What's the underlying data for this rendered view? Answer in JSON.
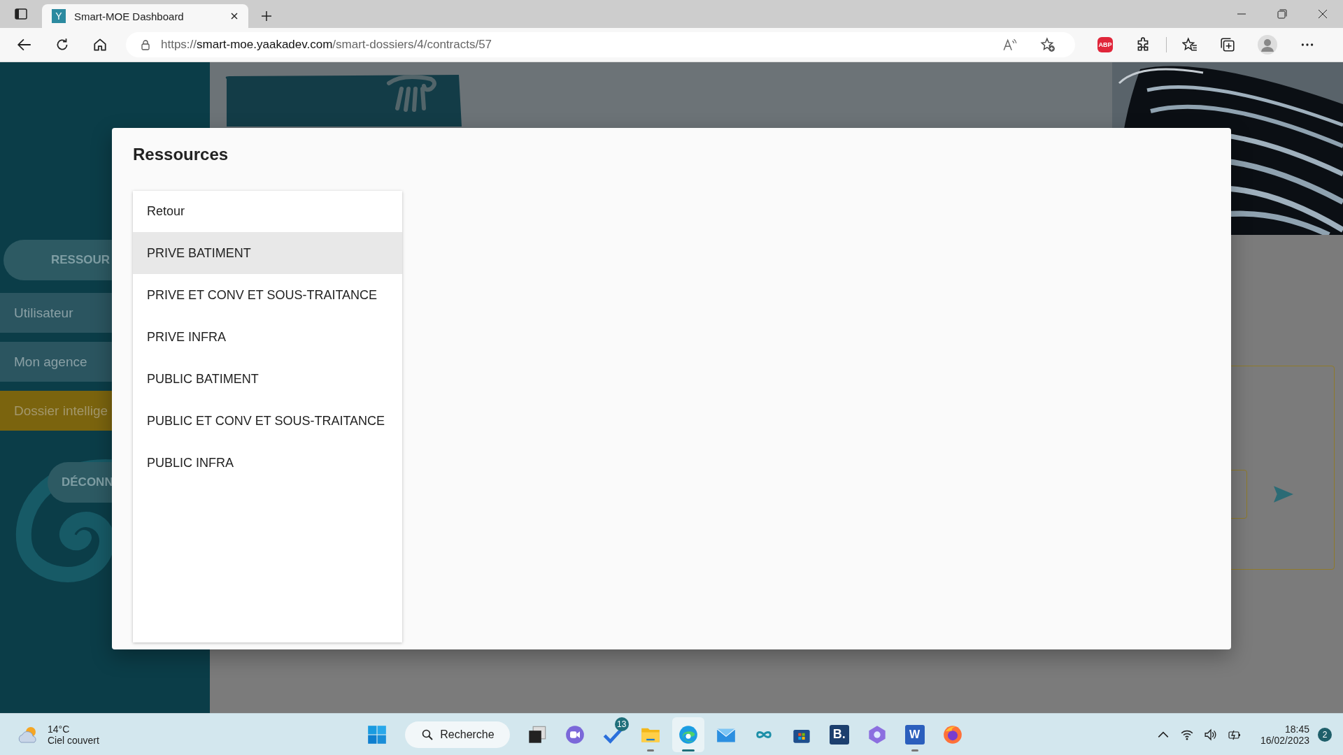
{
  "browser": {
    "tab": {
      "favicon": "Y",
      "title": "Smart-MOE Dashboard",
      "selected": true
    },
    "url": {
      "scheme": "https://",
      "host": "smart-moe.yaakadev.com",
      "path": "/smart-dossiers/4/contracts/57"
    },
    "extension_badge": "ABP"
  },
  "sidebar": {
    "items": [
      {
        "kind": "pill",
        "label": "RESSOUR"
      },
      {
        "kind": "row",
        "label": "Utilisateur",
        "selected": false
      },
      {
        "kind": "row",
        "label": "Mon agence",
        "selected": false
      },
      {
        "kind": "row",
        "label": "Dossier intellige",
        "selected": true
      },
      {
        "kind": "pill",
        "label": "DÉCONN"
      }
    ]
  },
  "modal": {
    "title": "Ressources",
    "items": [
      {
        "label": "Retour",
        "selected": false
      },
      {
        "label": "PRIVE BATIMENT",
        "selected": true
      },
      {
        "label": "PRIVE ET CONV ET SOUS-TRAITANCE",
        "selected": false
      },
      {
        "label": "PRIVE INFRA",
        "selected": false
      },
      {
        "label": "PUBLIC BATIMENT",
        "selected": false
      },
      {
        "label": "PUBLIC ET CONV ET SOUS-TRAITANCE",
        "selected": false
      },
      {
        "label": "PUBLIC INFRA",
        "selected": false
      }
    ]
  },
  "taskbar": {
    "weather": {
      "temperature": "14°C",
      "condition": "Ciel couvert"
    },
    "search": "Recherche",
    "apps": [
      {
        "kind": "taskview",
        "running": false
      },
      {
        "kind": "chat",
        "running": false
      },
      {
        "kind": "todo",
        "badge": "13",
        "running": false
      },
      {
        "kind": "files",
        "running": true
      },
      {
        "kind": "edge",
        "running": true,
        "selected": true
      },
      {
        "kind": "mail",
        "running": false
      },
      {
        "kind": "loop",
        "running": false
      },
      {
        "kind": "store",
        "running": false
      },
      {
        "kind": "letter",
        "label": "B.",
        "running": false
      },
      {
        "kind": "copilot",
        "running": false
      },
      {
        "kind": "word",
        "label": "W",
        "running": true
      },
      {
        "kind": "firefox",
        "running": false
      }
    ],
    "time": "18:45",
    "date": "16/02/2023",
    "notifications": "2"
  }
}
